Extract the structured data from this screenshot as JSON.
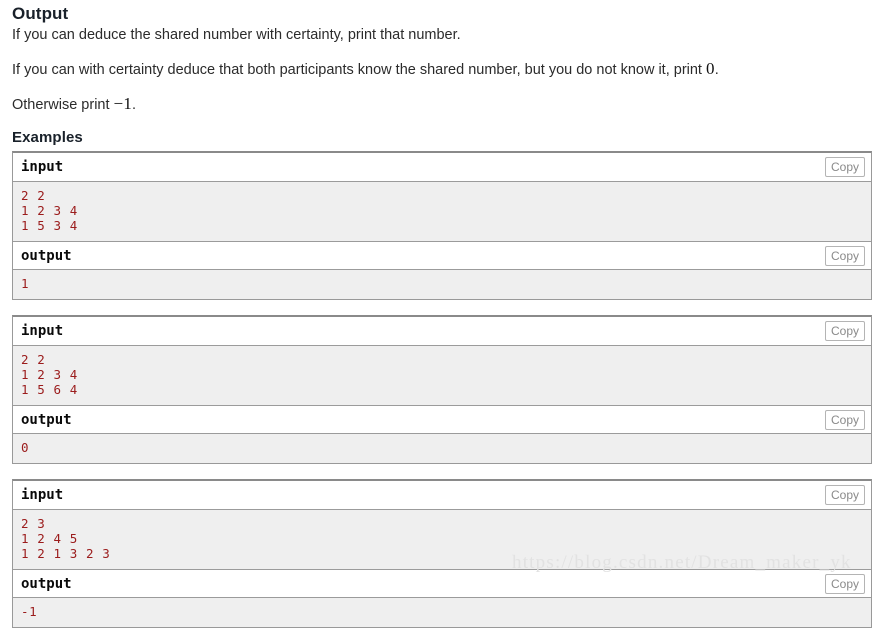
{
  "section": {
    "title": "Output",
    "paragraphs": [
      {
        "before": "If you can deduce the shared number with certainty, print that number.",
        "math": "",
        "after": ""
      },
      {
        "before": "If you can with certainty deduce that both participants know the shared number, but you do not know it, print ",
        "math": "0",
        "after": "."
      },
      {
        "before": "Otherwise print ",
        "math": "−1",
        "after": "."
      }
    ]
  },
  "examples": {
    "title": "Examples",
    "copy_label": "Copy",
    "input_label": "input",
    "output_label": "output",
    "tests": [
      {
        "input": "2 2\n1 2 3 4\n1 5 3 4",
        "output": "1"
      },
      {
        "input": "2 2\n1 2 3 4\n1 5 6 4",
        "output": "0"
      },
      {
        "input": "2 3\n1 2 4 5\n1 2 1 3 2 3",
        "output": "-1"
      }
    ]
  },
  "watermark": {
    "text": "https://blog.csdn.net/Dream_maker_yk"
  },
  "colors": {
    "sample_data_text": "#9b1c1c",
    "sample_data_bg": "#efefef",
    "border": "#999999",
    "copy_text": "#8a8a8a",
    "watermark": "#e2e2e2"
  }
}
